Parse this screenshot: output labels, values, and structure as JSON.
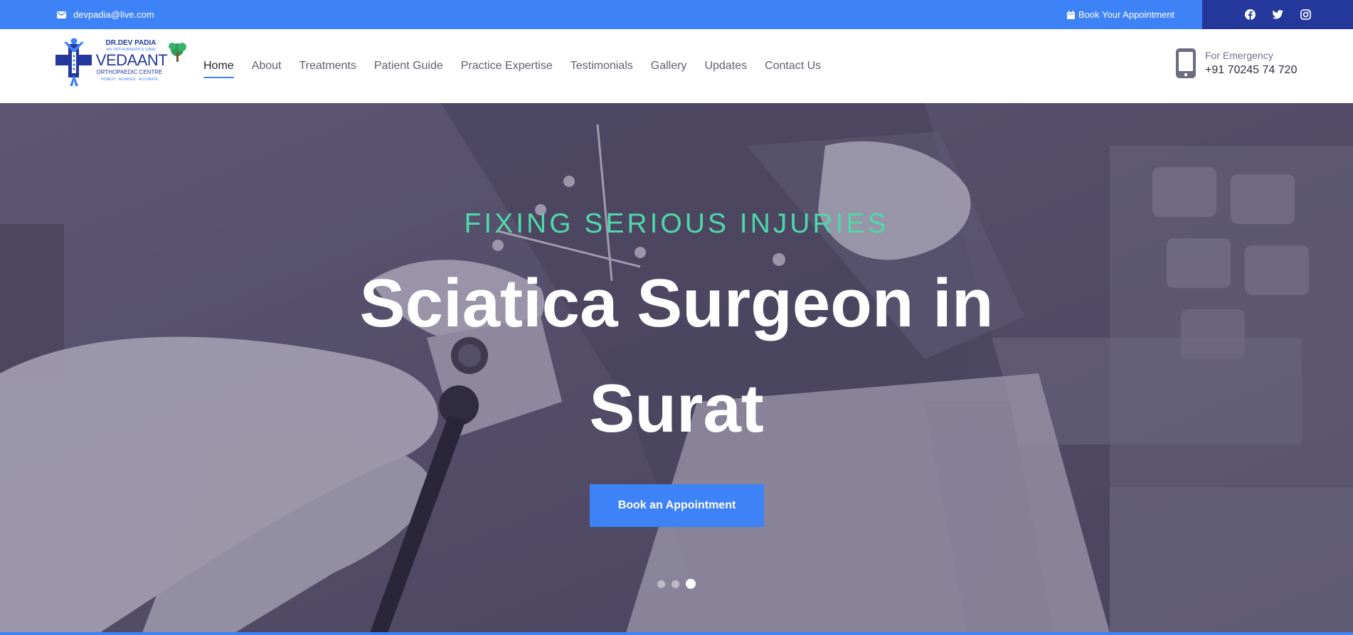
{
  "topbar": {
    "email": "devpadia@live.com",
    "appointment_label": "Book Your Appointment",
    "social_icons": [
      "facebook-icon",
      "twitter-icon",
      "instagram-icon"
    ]
  },
  "logo": {
    "line1": "DR.DEV PADIA",
    "line2": "MS ORTHOPAEDICS (UBA)",
    "brand": "VEDAANT",
    "line3": "ORTHOPAEDIC CENTRE",
    "tagline": "HONEST · ADVANCE · ACCURATE"
  },
  "nav": {
    "items": [
      {
        "label": "Home",
        "active": true
      },
      {
        "label": "About"
      },
      {
        "label": "Treatments"
      },
      {
        "label": "Patient Guide"
      },
      {
        "label": "Practice Expertise"
      },
      {
        "label": "Testimonials"
      },
      {
        "label": "Gallery"
      },
      {
        "label": "Updates"
      },
      {
        "label": "Contact Us"
      }
    ]
  },
  "emergency": {
    "label": "For Emergency",
    "number": "+91 70245 74 720"
  },
  "hero": {
    "kicker": "FIXING SERIOUS INJURIES",
    "title": "Sciatica Surgeon in Surat",
    "button": "Book an Appointment",
    "slides_total": 3,
    "active_slide": 3
  },
  "colors": {
    "primary": "#3d82f6",
    "social_bg": "#24389c",
    "accent_green": "#4fd8a8",
    "overlay": "#5c5670"
  }
}
